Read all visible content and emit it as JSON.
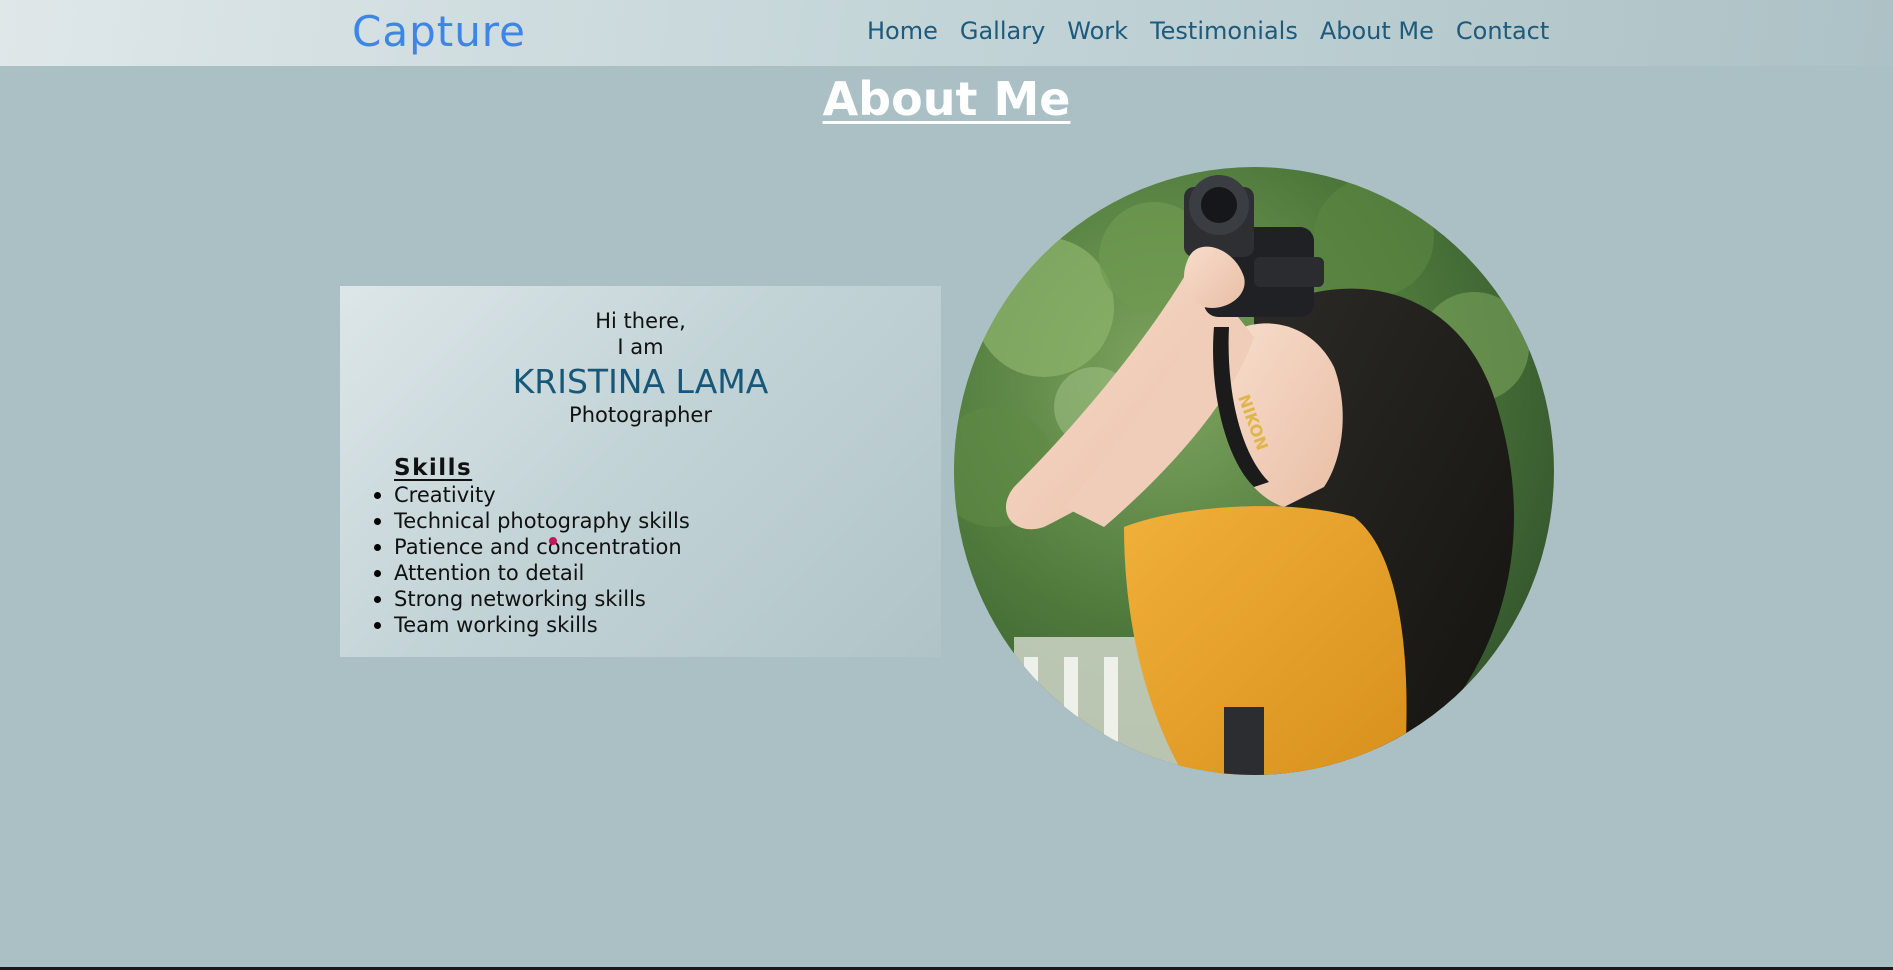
{
  "header": {
    "brand": "Capture",
    "nav": [
      "Home",
      "Gallary",
      "Work",
      "Testimonials",
      "About Me",
      "Contact"
    ]
  },
  "page_title": "About Me",
  "intro": {
    "greeting": "Hi there,",
    "lead": "I am",
    "name": "KRISTINA LAMA",
    "role": "Photographer"
  },
  "skills": {
    "heading": "Skills",
    "items": [
      "Creativity",
      "Technical photography skills",
      "Patience and concentration",
      "Attention to detail",
      "Strong networking skills",
      "Team working skills"
    ]
  },
  "photo": {
    "camera_brand": "NIKON"
  },
  "colors": {
    "background": "#abc0c4",
    "brand": "#3e86e6",
    "nav_link": "#1d5a7c",
    "name": "#17587a",
    "title": "#ffffff"
  },
  "icons": [
    "profile-photo"
  ]
}
